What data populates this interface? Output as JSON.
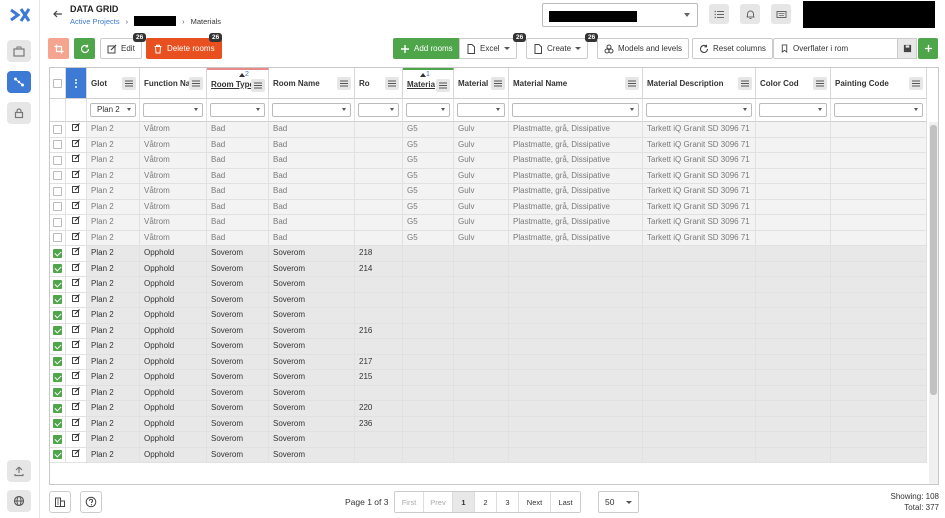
{
  "app": {
    "title": "DATA GRID",
    "breadcrumb": {
      "parent": "Active Projects",
      "current": "Materials"
    }
  },
  "toolbar": {
    "edit_label": "Edit",
    "edit_badge": "26",
    "delete_label": "Delete rooms",
    "delete_badge": "26",
    "add_label": "Add rooms",
    "excel_label": "Excel",
    "excel_badge": "26",
    "create_label": "Create",
    "create_badge": "26",
    "models_label": "Models and levels",
    "reset_label": "Reset columns",
    "view_label": "Overflater i rom"
  },
  "grid": {
    "columns": [
      {
        "label": "Glot",
        "filter": "Plan 2"
      },
      {
        "label": "Function Na",
        "filter": ""
      },
      {
        "label": "Room Type",
        "filter": "",
        "sort": "2"
      },
      {
        "label": "Room Name",
        "filter": ""
      },
      {
        "label": "Ro",
        "filter": ""
      },
      {
        "label": "Materia",
        "filter": "",
        "sort": "1"
      },
      {
        "label": "Material",
        "filter": ""
      },
      {
        "label": "Material Name",
        "filter": ""
      },
      {
        "label": "Material Description",
        "filter": ""
      },
      {
        "label": "Color Cod",
        "filter": ""
      },
      {
        "label": "Painting Code",
        "filter": ""
      }
    ],
    "rows": [
      {
        "checked": false,
        "cells": [
          "Plan 2",
          "Våtrom",
          "Bad",
          "Bad",
          "",
          "G5",
          "Gulv",
          "Plastmatte, grå, Dissipative",
          "Tarkett iQ Granit SD 3096 71",
          "",
          ""
        ]
      },
      {
        "checked": false,
        "cells": [
          "Plan 2",
          "Våtrom",
          "Bad",
          "Bad",
          "",
          "G5",
          "Gulv",
          "Plastmatte, grå, Dissipative",
          "Tarkett iQ Granit SD 3096 71",
          "",
          ""
        ]
      },
      {
        "checked": false,
        "cells": [
          "Plan 2",
          "Våtrom",
          "Bad",
          "Bad",
          "",
          "G5",
          "Gulv",
          "Plastmatte, grå, Dissipative",
          "Tarkett iQ Granit SD 3096 71",
          "",
          ""
        ]
      },
      {
        "checked": false,
        "cells": [
          "Plan 2",
          "Våtrom",
          "Bad",
          "Bad",
          "",
          "G5",
          "Gulv",
          "Plastmatte, grå, Dissipative",
          "Tarkett iQ Granit SD 3096 71",
          "",
          ""
        ]
      },
      {
        "checked": false,
        "cells": [
          "Plan 2",
          "Våtrom",
          "Bad",
          "Bad",
          "",
          "G5",
          "Gulv",
          "Plastmatte, grå, Dissipative",
          "Tarkett iQ Granit SD 3096 71",
          "",
          ""
        ]
      },
      {
        "checked": false,
        "cells": [
          "Plan 2",
          "Våtrom",
          "Bad",
          "Bad",
          "",
          "G5",
          "Gulv",
          "Plastmatte, grå, Dissipative",
          "Tarkett iQ Granit SD 3096 71",
          "",
          ""
        ]
      },
      {
        "checked": false,
        "cells": [
          "Plan 2",
          "Våtrom",
          "Bad",
          "Bad",
          "",
          "G5",
          "Gulv",
          "Plastmatte, grå, Dissipative",
          "Tarkett iQ Granit SD 3096 71",
          "",
          ""
        ]
      },
      {
        "checked": false,
        "cells": [
          "Plan 2",
          "Våtrom",
          "Bad",
          "Bad",
          "",
          "G5",
          "Gulv",
          "Plastmatte, grå, Dissipative",
          "Tarkett iQ Granit SD 3096 71",
          "",
          ""
        ]
      },
      {
        "checked": true,
        "cells": [
          "Plan 2",
          "Opphold",
          "Soverom",
          "Soverom",
          "218",
          "",
          "",
          "",
          "",
          "",
          ""
        ]
      },
      {
        "checked": true,
        "cells": [
          "Plan 2",
          "Opphold",
          "Soverom",
          "Soverom",
          "214",
          "",
          "",
          "",
          "",
          "",
          ""
        ]
      },
      {
        "checked": true,
        "cells": [
          "Plan 2",
          "Opphold",
          "Soverom",
          "Soverom",
          "",
          "",
          "",
          "",
          "",
          "",
          ""
        ]
      },
      {
        "checked": true,
        "cells": [
          "Plan 2",
          "Opphold",
          "Soverom",
          "Soverom",
          "",
          "",
          "",
          "",
          "",
          "",
          ""
        ]
      },
      {
        "checked": true,
        "cells": [
          "Plan 2",
          "Opphold",
          "Soverom",
          "Soverom",
          "",
          "",
          "",
          "",
          "",
          "",
          ""
        ]
      },
      {
        "checked": true,
        "cells": [
          "Plan 2",
          "Opphold",
          "Soverom",
          "Soverom",
          "216",
          "",
          "",
          "",
          "",
          "",
          ""
        ]
      },
      {
        "checked": true,
        "cells": [
          "Plan 2",
          "Opphold",
          "Soverom",
          "Soverom",
          "",
          "",
          "",
          "",
          "",
          "",
          ""
        ]
      },
      {
        "checked": true,
        "cells": [
          "Plan 2",
          "Opphold",
          "Soverom",
          "Soverom",
          "217",
          "",
          "",
          "",
          "",
          "",
          ""
        ]
      },
      {
        "checked": true,
        "cells": [
          "Plan 2",
          "Opphold",
          "Soverom",
          "Soverom",
          "215",
          "",
          "",
          "",
          "",
          "",
          ""
        ]
      },
      {
        "checked": true,
        "cells": [
          "Plan 2",
          "Opphold",
          "Soverom",
          "Soverom",
          "",
          "",
          "",
          "",
          "",
          "",
          ""
        ]
      },
      {
        "checked": true,
        "cells": [
          "Plan 2",
          "Opphold",
          "Soverom",
          "Soverom",
          "220",
          "",
          "",
          "",
          "",
          "",
          ""
        ]
      },
      {
        "checked": true,
        "cells": [
          "Plan 2",
          "Opphold",
          "Soverom",
          "Soverom",
          "236",
          "",
          "",
          "",
          "",
          "",
          ""
        ]
      },
      {
        "checked": true,
        "cells": [
          "Plan 2",
          "Opphold",
          "Soverom",
          "Soverom",
          "",
          "",
          "",
          "",
          "",
          "",
          ""
        ]
      },
      {
        "checked": true,
        "cells": [
          "Plan 2",
          "Opphold",
          "Soverom",
          "Soverom",
          "",
          "",
          "",
          "",
          "",
          "",
          ""
        ]
      }
    ]
  },
  "footer": {
    "page_info": "Page 1 of 3",
    "pager": [
      "First",
      "Prev",
      "1",
      "2",
      "3",
      "Next",
      "Last"
    ],
    "current_page": "1",
    "page_size": "50",
    "showing": "Showing: 108",
    "total": "Total: 377"
  },
  "colors": {
    "accent": "#3d7ad6",
    "green": "#4fa54a",
    "danger": "#e8501f"
  },
  "icons": [
    "logo-icon",
    "briefcase-icon",
    "network-icon",
    "lock-icon",
    "back-arrow-icon",
    "list-icon",
    "bell-icon",
    "keyboard-icon",
    "crop-icon",
    "refresh-icon",
    "edit-icon",
    "trash-icon",
    "plus-icon",
    "file-icon",
    "layers-icon",
    "reset-icon",
    "bookmark-icon",
    "save-icon",
    "upload-icon",
    "globe-icon",
    "building-icon",
    "help-icon"
  ]
}
